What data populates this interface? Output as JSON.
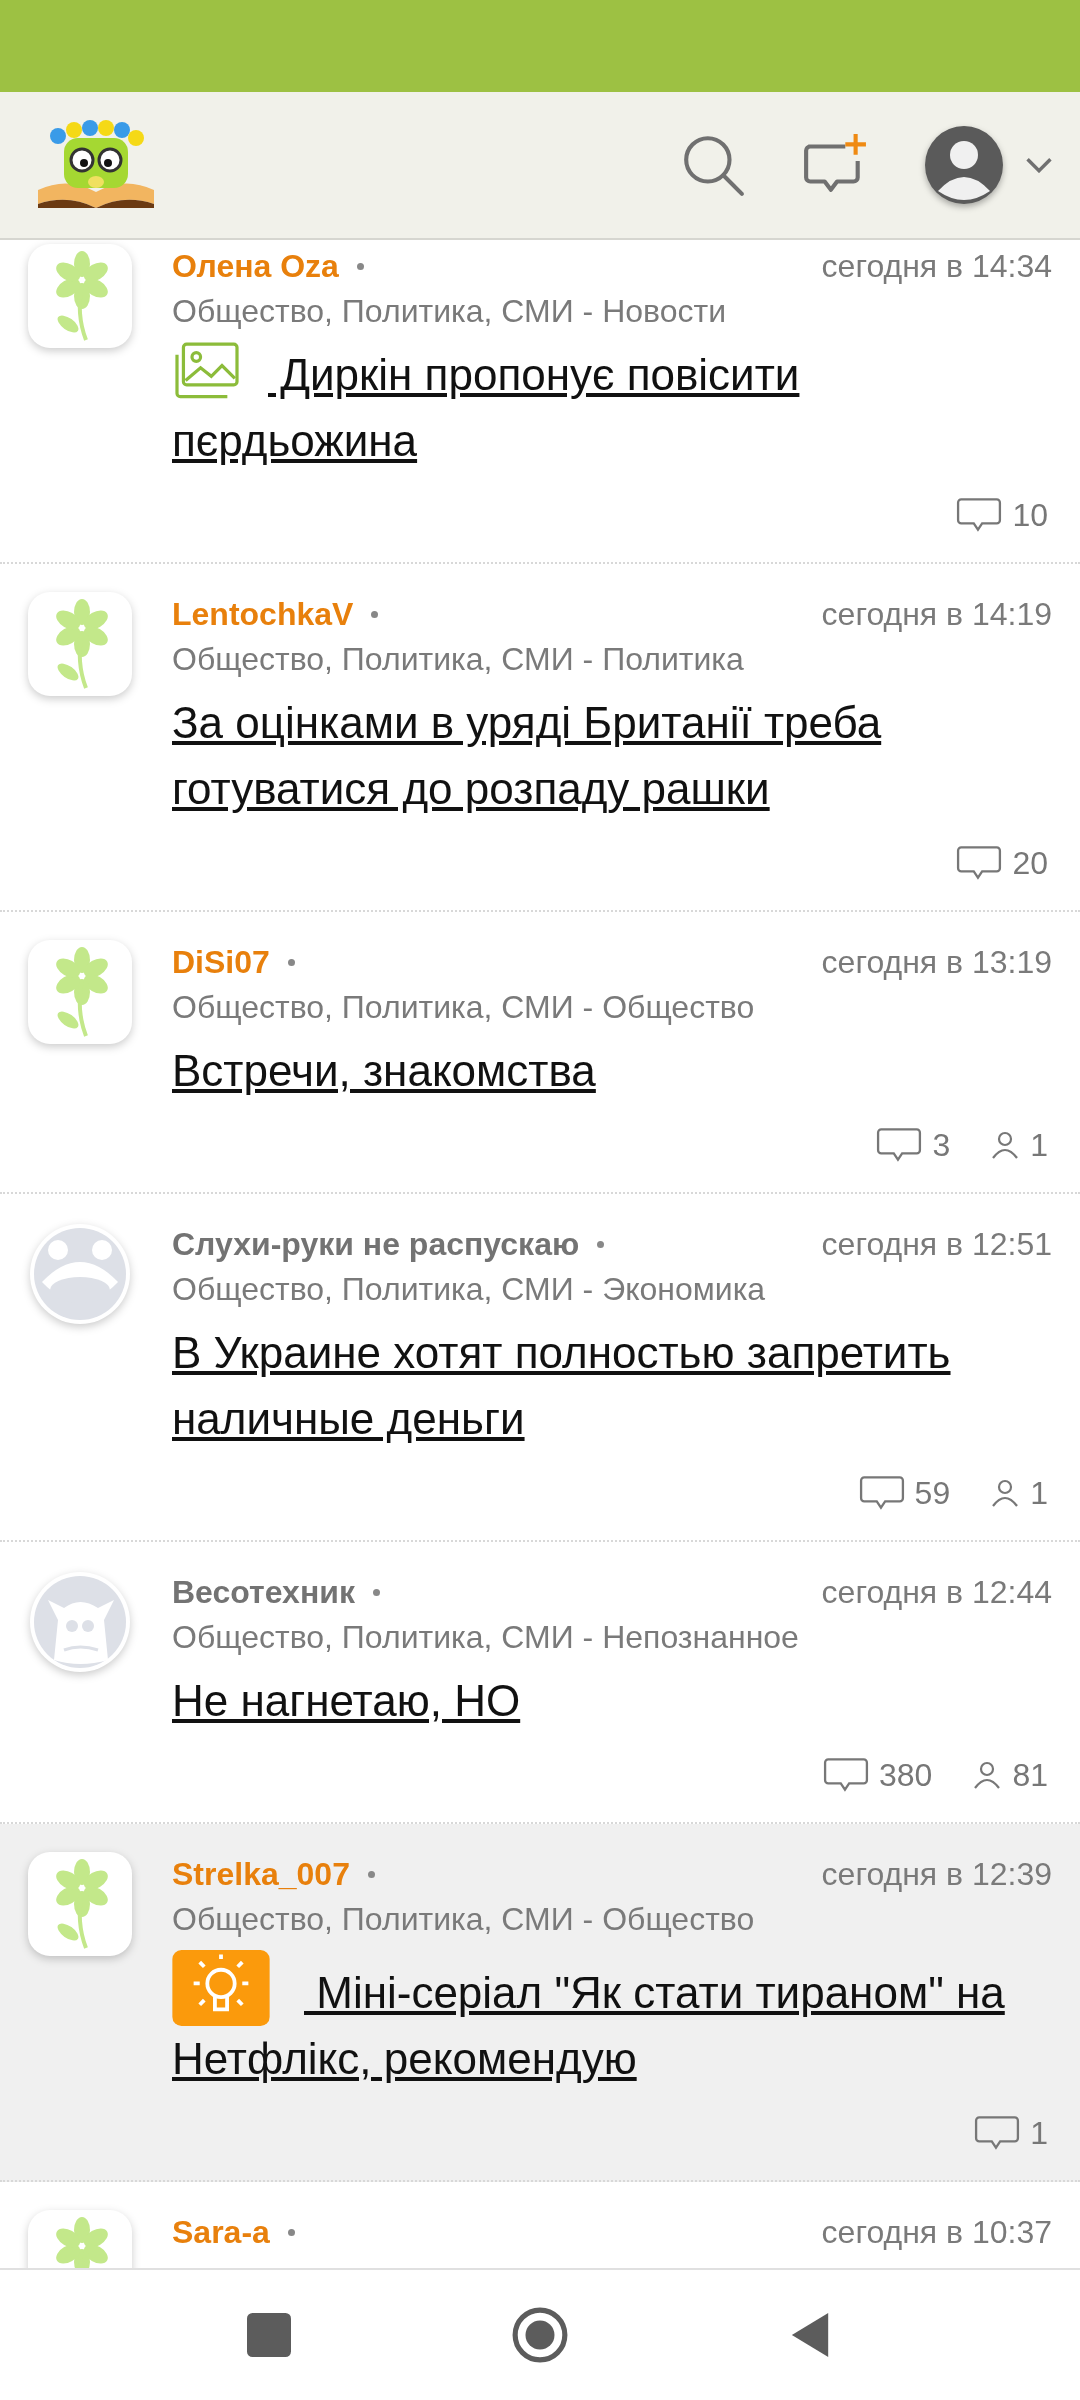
{
  "posts": [
    {
      "avatar": {
        "kind": "flower"
      },
      "author": "Олена Oza",
      "color": "#e8800c",
      "time": "сегодня в 14:34",
      "category": "Общество, Политика, СМИ - Новости",
      "title_icon": {
        "kind": "image"
      },
      "title": "Диркін пропонує повісити пєрдьожина",
      "comments": "10",
      "highlighted": false
    },
    {
      "avatar": {
        "kind": "flower"
      },
      "author": "LentochkaV",
      "color": "#e8800c",
      "time": "сегодня в 14:19",
      "category": "Общество, Политика, СМИ - Политика",
      "title": "За оцінками в уряді Британії треба готуватися до розпаду рашки",
      "comments": "20",
      "highlighted": false
    },
    {
      "avatar": {
        "kind": "flower"
      },
      "author": "DiSi07",
      "color": "#e8800c",
      "time": "сегодня в 13:19",
      "category": "Общество, Политика, СМИ - Общество",
      "title": "Встречи, знакомства",
      "comments": "3",
      "participants": "1",
      "highlighted": false
    },
    {
      "avatar": {
        "kind": "frog"
      },
      "author": "Слухи-руки не распускаю",
      "color": "#737373",
      "time": "сегодня в 12:51",
      "category": "Общество, Политика, СМИ - Экономика",
      "title": "В Украине хотят полностью запретить наличные деньги",
      "comments": "59",
      "participants": "1",
      "highlighted": false
    },
    {
      "avatar": {
        "kind": "monster"
      },
      "author": "Весотехник",
      "color": "#737373",
      "time": "сегодня в 12:44",
      "category": "Общество, Политика, СМИ - Непознанное",
      "title": "Не нагнетаю, НО",
      "comments": "380",
      "participants": "81",
      "highlighted": false
    },
    {
      "avatar": {
        "kind": "flower"
      },
      "author": "Strelka_007",
      "color": "#e8800c",
      "time": "сегодня в 12:39",
      "category": "Общество, Политика, СМИ - Общество",
      "title_icon": {
        "kind": "idea"
      },
      "title": "Міні-серіал \"Як стати тираном\" на Нетфлікс, рекомендую",
      "comments": "1",
      "highlighted": true
    },
    {
      "avatar": {
        "kind": "flower"
      },
      "author": "Sara-a",
      "color": "#e8800c",
      "time": "сегодня в 10:37",
      "highlighted": false
    }
  ]
}
